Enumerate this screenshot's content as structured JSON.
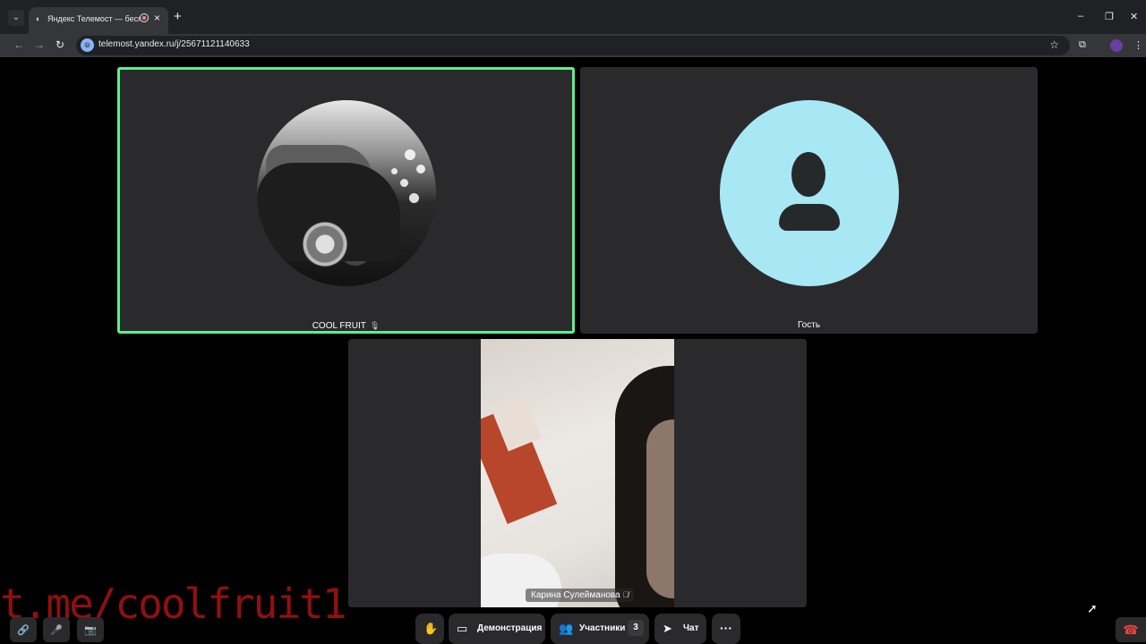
{
  "browser": {
    "tab_title": "Яндекс Телемост — беспл",
    "tab_favicon": "audio-favicon",
    "tab_close": "×",
    "new_tab": "+",
    "url": "telemost.yandex.ru/j/25671121140633",
    "window_controls": {
      "minimize": "–",
      "restore": "❐",
      "close": "✕"
    },
    "nav": {
      "back": "←",
      "forward": "→",
      "reload": "↻"
    },
    "star": "☆",
    "extensions": "⧉",
    "menu": "⋮",
    "tab_list": "⌄"
  },
  "participants": [
    {
      "name": "COOL FRUIT",
      "speaking": true,
      "avatar": "car-photo"
    },
    {
      "name": "Гость",
      "speaking": false,
      "avatar": "person-icon"
    },
    {
      "name": "Карина Сулейманова",
      "speaking": false,
      "mic_muted": true,
      "avatar": "video"
    }
  ],
  "watermark_text": "t.me/coolfruit1",
  "controls": {
    "raise_hand": "✋",
    "screen_share_label": "Демонстрация",
    "participants_label": "Участники",
    "participants_count": "3",
    "chat_label": "Чат",
    "more": "···",
    "link": "🔗",
    "mic": "🎤",
    "camera": "📷",
    "hangup": "☎"
  },
  "colors": {
    "speaking_border": "#5cf08a",
    "tile_bg": "#2a2a2d",
    "guest_avatar": "#a8e8f5",
    "hangup": "#e8453c"
  }
}
